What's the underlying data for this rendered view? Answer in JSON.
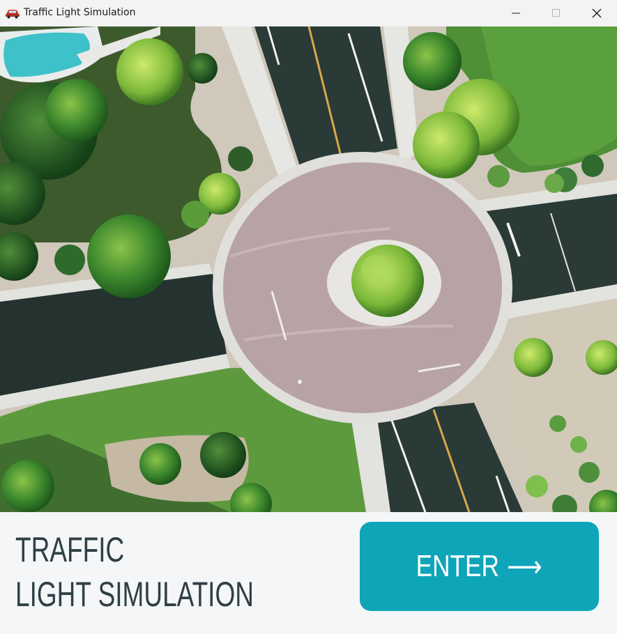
{
  "window": {
    "title": "Traffic Light Simulation",
    "app_icon": "car-icon",
    "controls": [
      "minimize-icon",
      "maximize-icon",
      "close-icon"
    ]
  },
  "hero": {
    "description_icon": "roundabout-aerial-image"
  },
  "panel": {
    "headline_line1": "TRAFFIC",
    "headline_line2": "LIGHT SIMULATION",
    "enter_label": "ENTER",
    "enter_arrow": "⟶"
  },
  "colors": {
    "accent": "#0ea5b9",
    "headline": "#2f3f46",
    "panel_bg": "#f4f6f8"
  }
}
